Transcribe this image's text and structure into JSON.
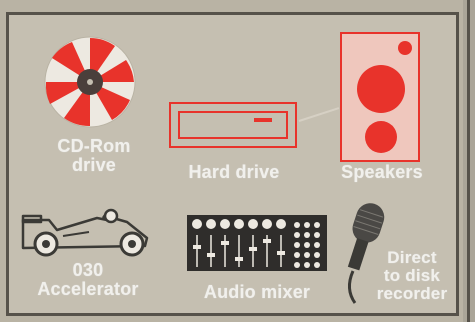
{
  "items": {
    "cdrom": {
      "label_line1": "CD-Rom",
      "label_line2": "drive"
    },
    "harddrive": {
      "label": "Hard drive"
    },
    "speakers": {
      "label": "Speakers"
    },
    "accelerator": {
      "label_line1": "030",
      "label_line2": "Accelerator"
    },
    "mixer": {
      "label": "Audio mixer"
    },
    "recorder": {
      "label_line1": "Direct",
      "label_line2": "to disk",
      "label_line3": "recorder"
    }
  },
  "colors": {
    "red": "#e8332b",
    "outline": "#3b3a36",
    "panel": "#c5bfb1",
    "label": "#f1f0ec"
  }
}
